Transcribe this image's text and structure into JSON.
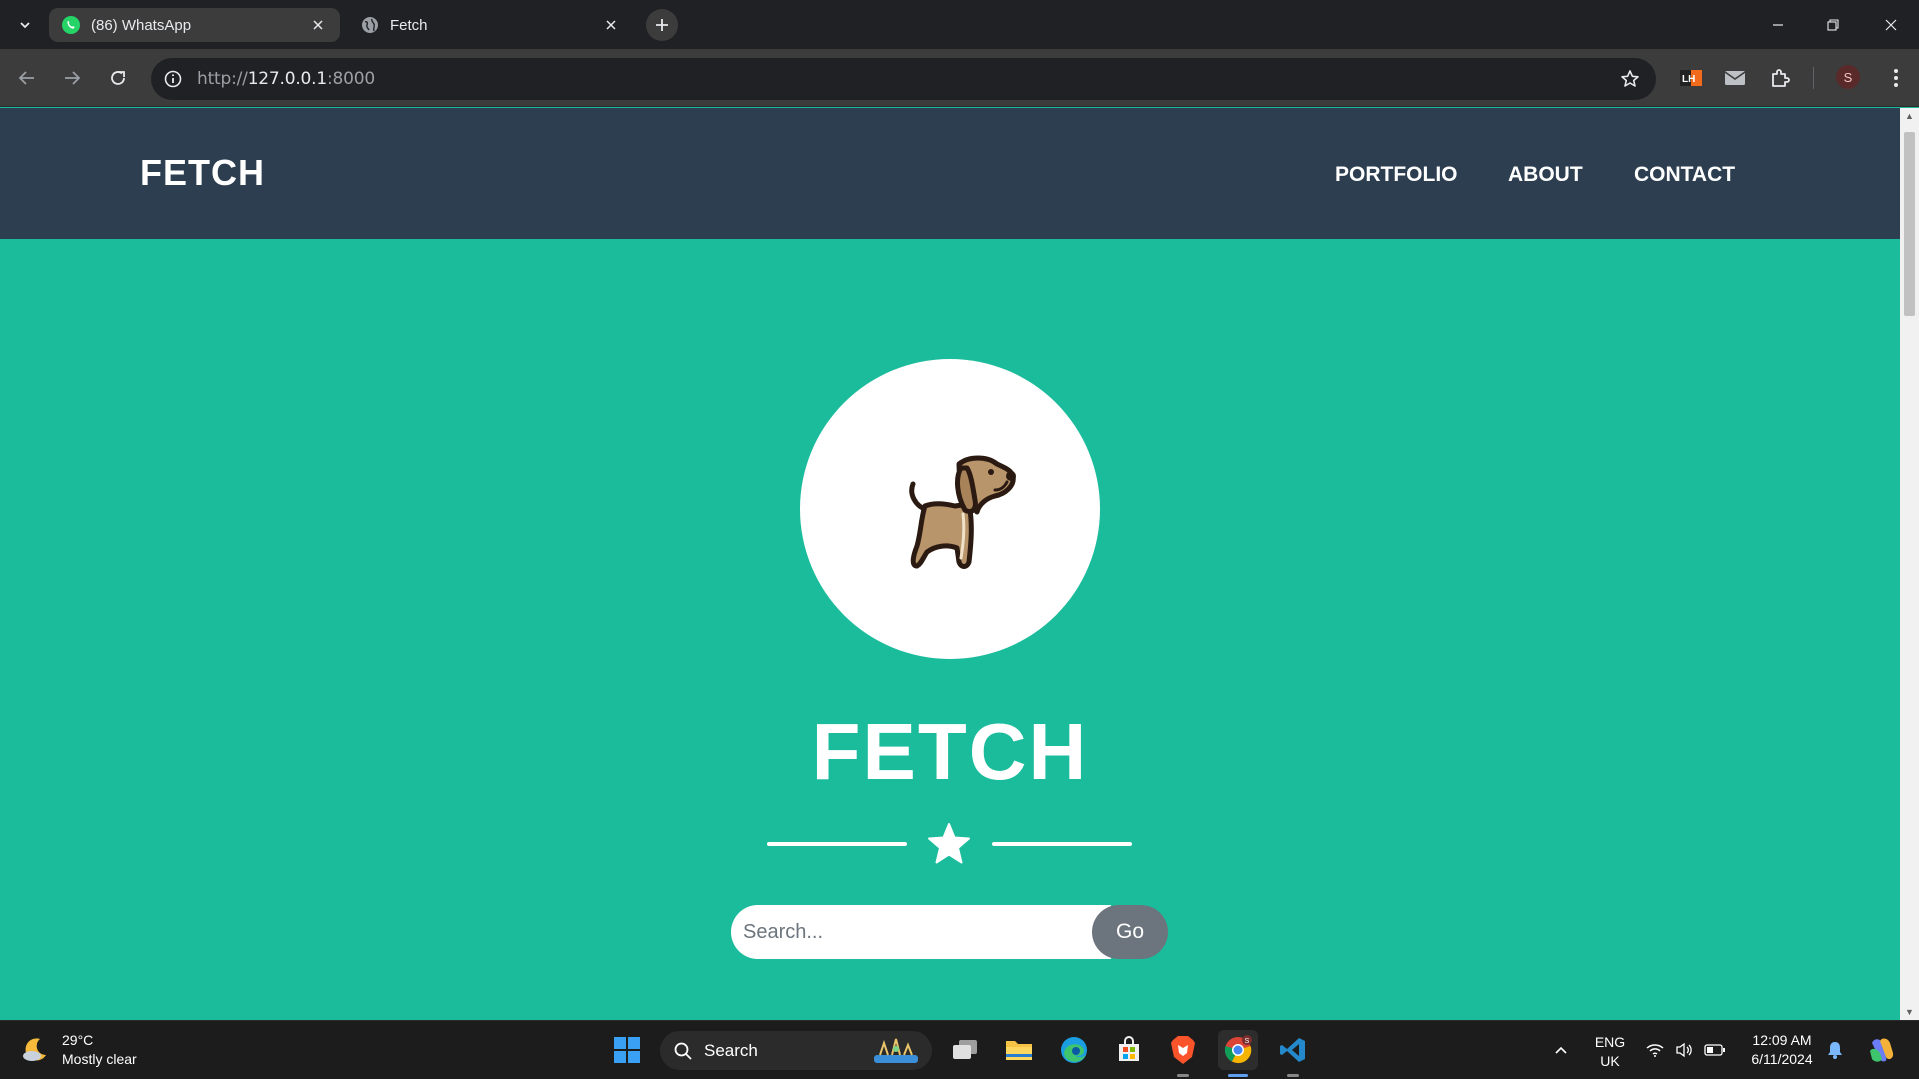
{
  "browser": {
    "tabs": [
      {
        "title": "(86) WhatsApp",
        "favicon": "whatsapp-icon",
        "active": false
      },
      {
        "title": "Fetch",
        "favicon": "globe-icon",
        "active": true
      }
    ],
    "url_scheme": "http://",
    "url_host": "127.0.0.1",
    "url_port": ":8000",
    "profile_initial": "S",
    "extension_lh_label": "LH"
  },
  "site": {
    "brand": "FETCH",
    "nav": {
      "portfolio": "PORTFOLIO",
      "about": "ABOUT",
      "contact": "CONTACT"
    },
    "hero_title": "FETCH",
    "search": {
      "placeholder": "Search...",
      "value": "",
      "button": "Go"
    }
  },
  "colors": {
    "navbar": "#2c3e50",
    "hero_bg": "#1abc9c",
    "button": "#6c757d"
  },
  "taskbar": {
    "weather_temp": "29°C",
    "weather_desc": "Mostly clear",
    "search_label": "Search",
    "lang_line1": "ENG",
    "lang_line2": "UK",
    "time": "12:09 AM",
    "date": "6/11/2024"
  }
}
